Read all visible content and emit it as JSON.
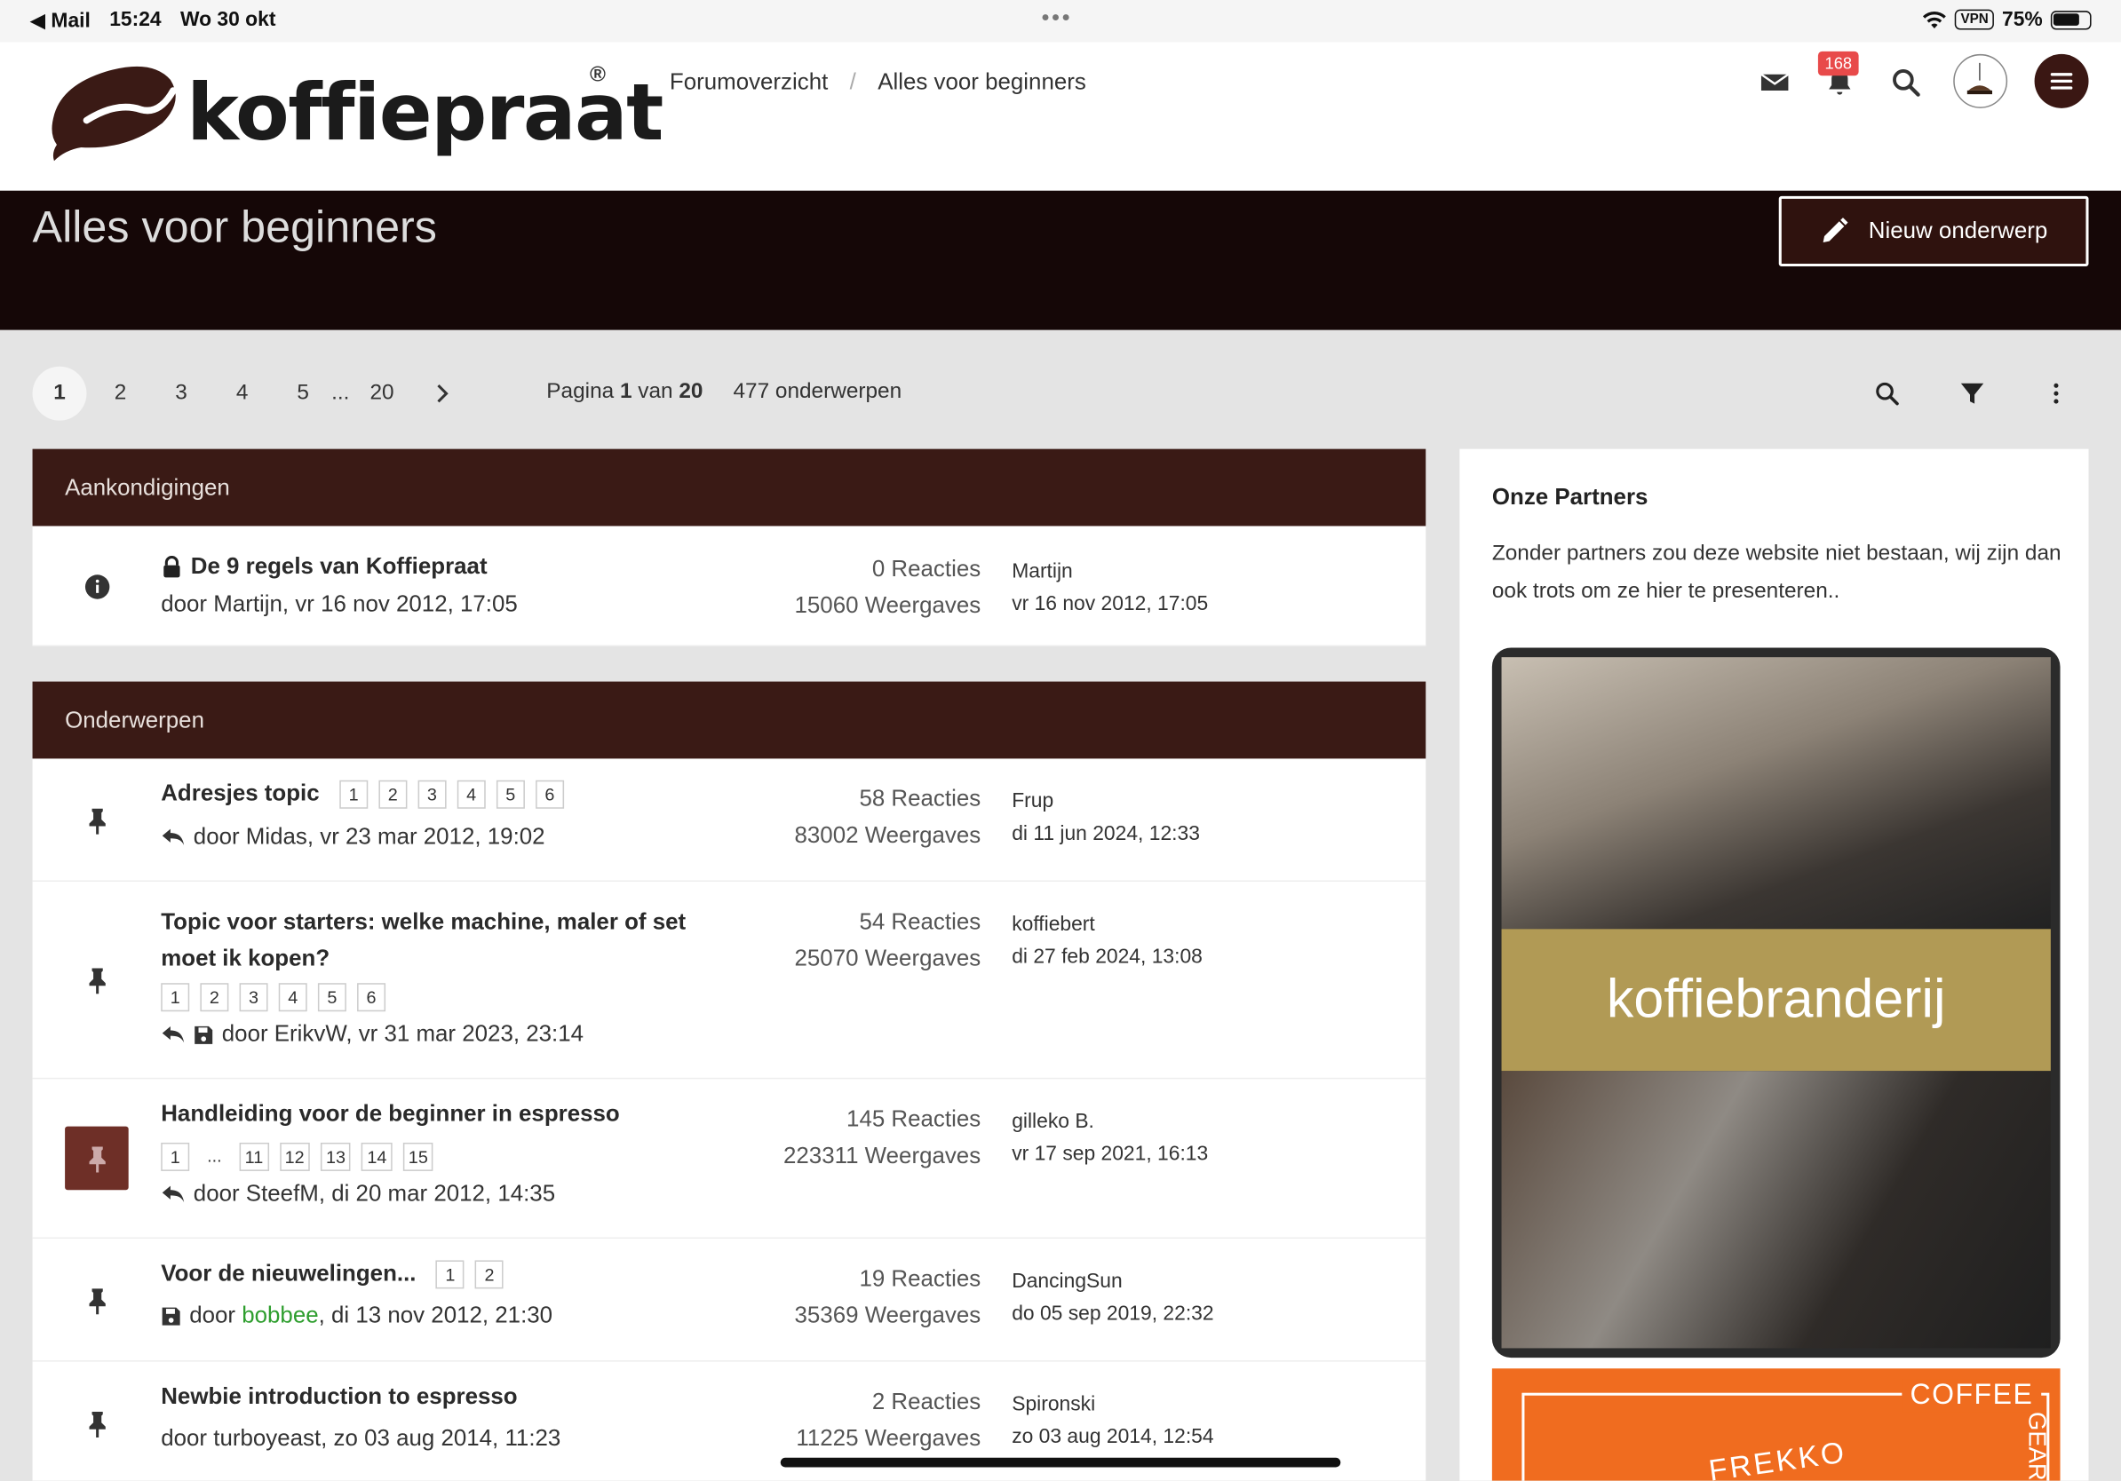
{
  "status": {
    "back_app": "Mail",
    "time": "15:24",
    "date": "Wo 30 okt",
    "vpn": "VPN",
    "battery": "75%",
    "battery_level": 0.75
  },
  "header": {
    "logo_text": "koffiepraat",
    "logo_reg": "®",
    "breadcrumb": [
      "Forumoverzicht",
      "Alles voor beginners"
    ],
    "notifications_count": "168"
  },
  "hero": {
    "title": "Alles voor beginners",
    "new_topic_label": "Nieuw onderwerp"
  },
  "pager": {
    "pages": [
      "1",
      "2",
      "3",
      "4",
      "5"
    ],
    "ellipsis": "...",
    "last": "20",
    "info_prefix": "Pagina ",
    "current": "1",
    "info_mid": " van ",
    "total": "20",
    "topic_count": "477 onderwerpen"
  },
  "announcements": {
    "heading": "Aankondigingen",
    "rows": [
      {
        "title": "De 9 regels van Koffiepraat",
        "meta": "door Martijn, vr 16 nov 2012, 17:05",
        "replies": "0 Reacties",
        "views": "15060 Weergaves",
        "last_user": "Martijn",
        "last_date": "vr 16 nov 2012, 17:05"
      }
    ]
  },
  "topics": {
    "heading": "Onderwerpen",
    "rows": [
      {
        "title": "Adresjes topic",
        "pages": [
          "1",
          "2",
          "3",
          "4",
          "5",
          "6"
        ],
        "meta_prefix": "door Midas, vr 23 mar 2012, 19:02",
        "replies": "58 Reacties",
        "views": "83002 Weergaves",
        "last_user": "Frup",
        "last_date": "di 11 jun 2024, 12:33"
      },
      {
        "title_line1": "Topic voor starters: welke machine, maler of set",
        "title_line2": "moet ik kopen?",
        "pages": [
          "1",
          "2",
          "3",
          "4",
          "5",
          "6"
        ],
        "meta_prefix": "door ErikvW, vr 31 mar 2023, 23:14",
        "replies": "54 Reacties",
        "views": "25070 Weergaves",
        "last_user": "koffiebert",
        "last_date": "di 27 feb 2024, 13:08"
      },
      {
        "title": "Handleiding voor de beginner in espresso",
        "pages": [
          "1",
          "...",
          "11",
          "12",
          "13",
          "14",
          "15"
        ],
        "meta_prefix": "door SteefM, di 20 mar 2012, 14:35",
        "replies": "145 Reacties",
        "views": "223311 Weergaves",
        "last_user": "gilleko B.",
        "last_date": "vr 17 sep 2021, 16:13"
      },
      {
        "title": "Voor de nieuwelingen...",
        "pages": [
          "1",
          "2"
        ],
        "meta_door": "door ",
        "meta_user": "bobbee",
        "meta_rest": ", di 13 nov 2012, 21:30",
        "replies": "19 Reacties",
        "views": "35369 Weergaves",
        "last_user": "DancingSun",
        "last_date": "do 05 sep 2019, 22:32"
      },
      {
        "title": "Newbie introduction to espresso",
        "meta_prefix": "door turboyeast, zo 03 aug 2014, 11:23",
        "replies": "2 Reacties",
        "views": "11225 Weergaves",
        "last_user": "Spironski",
        "last_date": "zo 03 aug 2014, 12:54"
      }
    ]
  },
  "sidebar": {
    "heading": "Onze Partners",
    "text": "Zonder partners zou deze website niet bestaan, wij zijn dan ook trots om ze hier te presenteren..",
    "partner1_label": "koffiebranderij",
    "partner2_coffee": "COFFEE",
    "partner2_brand": "FREKKO",
    "partner2_side": "GEAR"
  },
  "colors": {
    "brand_dark": "#3a1a15",
    "hero_bg": "#150707",
    "badge": "#e84a4a",
    "user_green": "#2e9e2e"
  }
}
